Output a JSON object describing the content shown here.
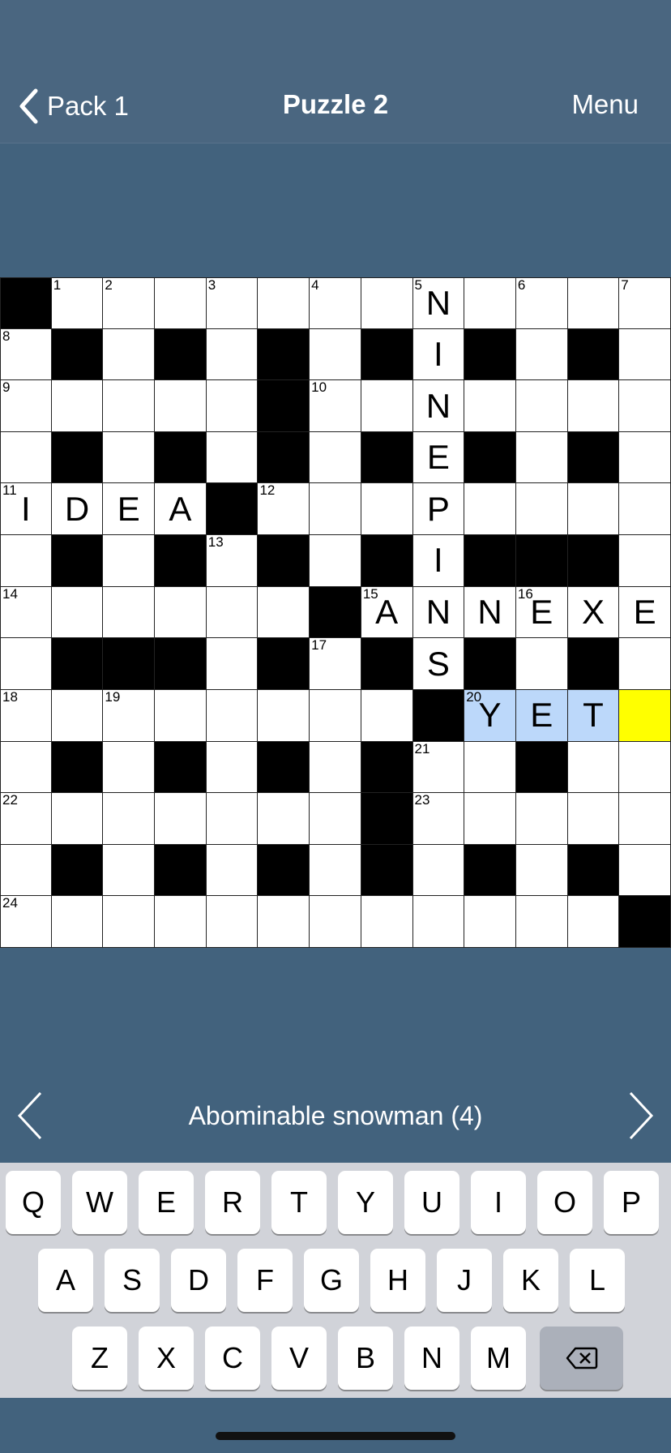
{
  "header": {
    "back_label": "Pack 1",
    "title": "Puzzle 2",
    "menu_label": "Menu"
  },
  "grid": {
    "rows": [
      "#............",
      ".#.#.#.#.#.#.",
      ".....#.......",
      ".#.#.#.#.#.#.",
      "....#........",
      ".#.#.#.#.###.",
      "......#......",
      ".###.#.#.#.#.",
      "........#....",
      ".#.#.#.#..#..",
      ".......#.....",
      ".#.#.#.#.#.#.",
      "............#"
    ],
    "numbers": [
      {
        "r": 0,
        "c": 1,
        "n": "1"
      },
      {
        "r": 0,
        "c": 2,
        "n": "2"
      },
      {
        "r": 0,
        "c": 4,
        "n": "3"
      },
      {
        "r": 0,
        "c": 6,
        "n": "4"
      },
      {
        "r": 0,
        "c": 8,
        "n": "5"
      },
      {
        "r": 0,
        "c": 10,
        "n": "6"
      },
      {
        "r": 0,
        "c": 12,
        "n": "7"
      },
      {
        "r": 1,
        "c": 0,
        "n": "8"
      },
      {
        "r": 2,
        "c": 0,
        "n": "9"
      },
      {
        "r": 2,
        "c": 6,
        "n": "10"
      },
      {
        "r": 4,
        "c": 0,
        "n": "11"
      },
      {
        "r": 4,
        "c": 5,
        "n": "12"
      },
      {
        "r": 5,
        "c": 4,
        "n": "13"
      },
      {
        "r": 6,
        "c": 0,
        "n": "14"
      },
      {
        "r": 6,
        "c": 7,
        "n": "15"
      },
      {
        "r": 6,
        "c": 10,
        "n": "16"
      },
      {
        "r": 7,
        "c": 6,
        "n": "17"
      },
      {
        "r": 8,
        "c": 0,
        "n": "18"
      },
      {
        "r": 8,
        "c": 2,
        "n": "19"
      },
      {
        "r": 8,
        "c": 9,
        "n": "20"
      },
      {
        "r": 9,
        "c": 8,
        "n": "21"
      },
      {
        "r": 10,
        "c": 0,
        "n": "22"
      },
      {
        "r": 10,
        "c": 8,
        "n": "23"
      },
      {
        "r": 12,
        "c": 0,
        "n": "24"
      }
    ],
    "letters": [
      {
        "r": 0,
        "c": 8,
        "ch": "N"
      },
      {
        "r": 1,
        "c": 8,
        "ch": "I"
      },
      {
        "r": 2,
        "c": 8,
        "ch": "N"
      },
      {
        "r": 3,
        "c": 8,
        "ch": "E"
      },
      {
        "r": 4,
        "c": 8,
        "ch": "P"
      },
      {
        "r": 5,
        "c": 8,
        "ch": "I"
      },
      {
        "r": 6,
        "c": 8,
        "ch": "N"
      },
      {
        "r": 7,
        "c": 8,
        "ch": "S"
      },
      {
        "r": 4,
        "c": 0,
        "ch": "I"
      },
      {
        "r": 4,
        "c": 1,
        "ch": "D"
      },
      {
        "r": 4,
        "c": 2,
        "ch": "E"
      },
      {
        "r": 4,
        "c": 3,
        "ch": "A"
      },
      {
        "r": 6,
        "c": 7,
        "ch": "A"
      },
      {
        "r": 6,
        "c": 9,
        "ch": "N"
      },
      {
        "r": 6,
        "c": 10,
        "ch": "E"
      },
      {
        "r": 6,
        "c": 11,
        "ch": "X"
      },
      {
        "r": 6,
        "c": 12,
        "ch": "E"
      },
      {
        "r": 8,
        "c": 9,
        "ch": "Y"
      },
      {
        "r": 8,
        "c": 10,
        "ch": "E"
      },
      {
        "r": 8,
        "c": 11,
        "ch": "T"
      }
    ],
    "highlight": [
      {
        "r": 8,
        "c": 9
      },
      {
        "r": 8,
        "c": 10
      },
      {
        "r": 8,
        "c": 11
      }
    ],
    "cursor": {
      "r": 8,
      "c": 12
    },
    "colors": {
      "highlight": "#bcd8fa",
      "cursor": "#ffff00"
    }
  },
  "clue": {
    "text": "Abominable snowman (4)"
  },
  "keyboard": {
    "rows": [
      [
        "Q",
        "W",
        "E",
        "R",
        "T",
        "Y",
        "U",
        "I",
        "O",
        "P"
      ],
      [
        "A",
        "S",
        "D",
        "F",
        "G",
        "H",
        "J",
        "K",
        "L"
      ],
      [
        "Z",
        "X",
        "C",
        "V",
        "B",
        "N",
        "M"
      ]
    ],
    "delete_icon": "backspace-icon"
  },
  "colors": {
    "background": "#42627d",
    "header": "#4a6680"
  }
}
